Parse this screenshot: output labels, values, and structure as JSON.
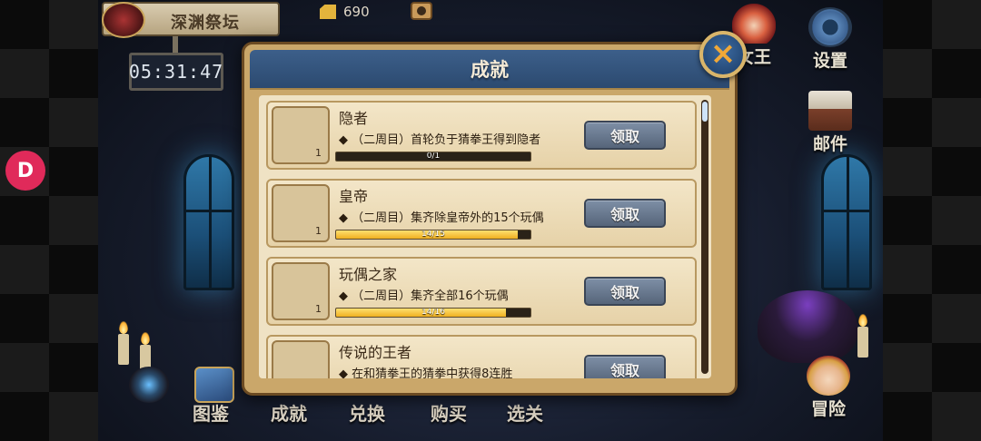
{
  "scene": {
    "location_title": "深渊祭坛",
    "timer": "05:31:47",
    "gold": "690",
    "float_button": "D"
  },
  "right_menu": {
    "queen": "女王",
    "settings": "设置",
    "mail": "邮件",
    "adventure": "冒险"
  },
  "bottom_menu": {
    "gallery": "图鉴",
    "achievements": "成就",
    "exchange": "兑换",
    "buy": "购买",
    "levels": "选关"
  },
  "modal": {
    "title": "成就",
    "close": "×",
    "achievements": [
      {
        "title": "隐者",
        "desc": "◆ （二周目）首轮负于猜拳王得到隐者",
        "qty": "1",
        "progress_label": "0/1",
        "progress": 0.0,
        "claim": "领取"
      },
      {
        "title": "皇帝",
        "desc": "◆ （二周目）集齐除皇帝外的15个玩偶",
        "qty": "1",
        "progress_label": "14/15",
        "progress": 0.933,
        "claim": "领取"
      },
      {
        "title": "玩偶之家",
        "desc": "◆ （二周目）集齐全部16个玩偶",
        "qty": "1",
        "progress_label": "14/16",
        "progress": 0.875,
        "claim": "领取"
      },
      {
        "title": "传说的王者",
        "desc": "◆ 在和猜拳王的猜拳中获得8连胜",
        "qty": "",
        "progress_label": "",
        "progress": 0,
        "claim": "领取"
      }
    ]
  }
}
